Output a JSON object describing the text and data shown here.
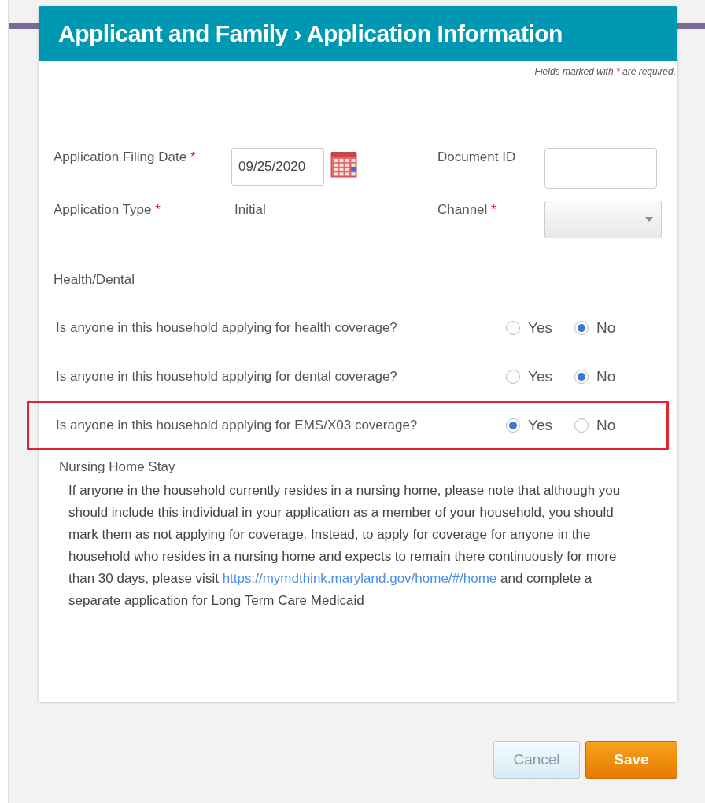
{
  "dialog": {
    "title": "Applicant and Family › Application Information",
    "required_note": {
      "before": "Fields marked with",
      "mark": "*",
      "after": "are required."
    },
    "fields_left": [
      {
        "kind": "date",
        "label": "Application Filing Date",
        "required_mark": "*",
        "value": "09/25/2020"
      },
      {
        "kind": "text",
        "label": "Application Type",
        "required_mark": "*",
        "value": "Initial"
      }
    ],
    "fields_right": [
      {
        "kind": "input",
        "label": "Document ID"
      },
      {
        "kind": "select",
        "label": "Channel",
        "required_mark": "*"
      }
    ],
    "section_title": "Health/Dental",
    "questions": [
      {
        "text": "Is anyone in this household applying for health coverage?",
        "highlighted": false,
        "options": [
          {
            "label": "Yes",
            "selected": false
          },
          {
            "label": "No",
            "selected": true
          }
        ]
      },
      {
        "text": "Is anyone in this household applying for dental coverage?",
        "highlighted": false,
        "options": [
          {
            "label": "Yes",
            "selected": false
          },
          {
            "label": "No",
            "selected": true
          }
        ]
      },
      {
        "text": "Is anyone in this household applying for EMS/X03 coverage?",
        "highlighted": true,
        "options": [
          {
            "label": "Yes",
            "selected": true
          },
          {
            "label": "No",
            "selected": false
          }
        ]
      }
    ],
    "nursing": {
      "title": "Nursing Home Stay",
      "text_before": "If anyone in the household currently resides in a nursing home, please note that although you should include this individual in your application as a member of your household, you should mark them as not applying for coverage. Instead, to apply for coverage for anyone in the household who resides in a nursing home and expects to remain there continuously for more than 30 days, please visit",
      "link": "https://mymdthink.maryland.gov/home/#/home",
      "text_after": "and complete a separate application for Long Term Care Medicaid"
    }
  },
  "buttons": [
    {
      "kind": "secondary",
      "label": "Cancel"
    },
    {
      "kind": "primary",
      "label": "Save"
    }
  ]
}
